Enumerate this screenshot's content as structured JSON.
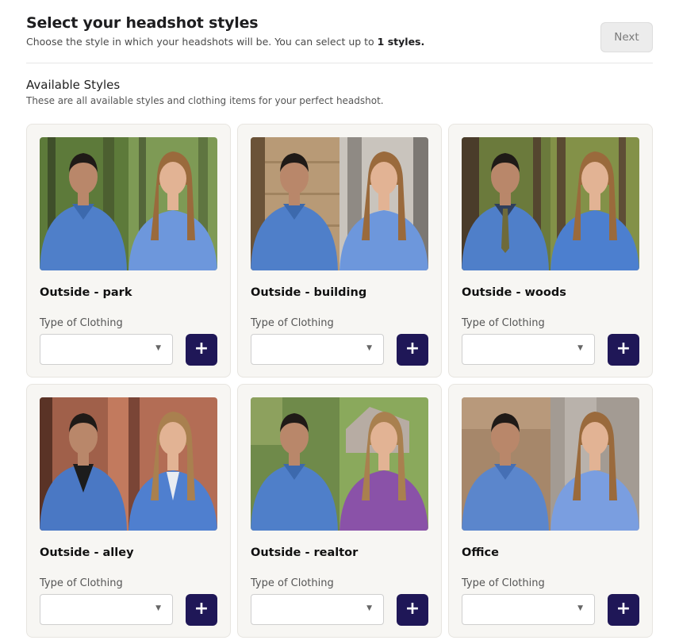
{
  "header": {
    "title": "Select your headshot styles",
    "subtitle_prefix": "Choose the style in which your headshots will be. You can select up to ",
    "subtitle_bold": "1 styles.",
    "next_label": "Next"
  },
  "section": {
    "title": "Available Styles",
    "subtitle": "These are all available styles and clothing items for your perfect headshot."
  },
  "clothing_label": "Type of Clothing",
  "add_icon": "plus-icon",
  "cards": [
    {
      "name": "Outside - park",
      "select_value": ""
    },
    {
      "name": "Outside - building",
      "select_value": ""
    },
    {
      "name": "Outside - woods",
      "select_value": ""
    },
    {
      "name": "Outside - alley",
      "select_value": ""
    },
    {
      "name": "Outside - realtor",
      "select_value": ""
    },
    {
      "name": "Office",
      "select_value": ""
    }
  ],
  "colors": {
    "accent": "#1f1757",
    "card_bg": "#f7f6f3",
    "next_bg": "#ececec"
  }
}
